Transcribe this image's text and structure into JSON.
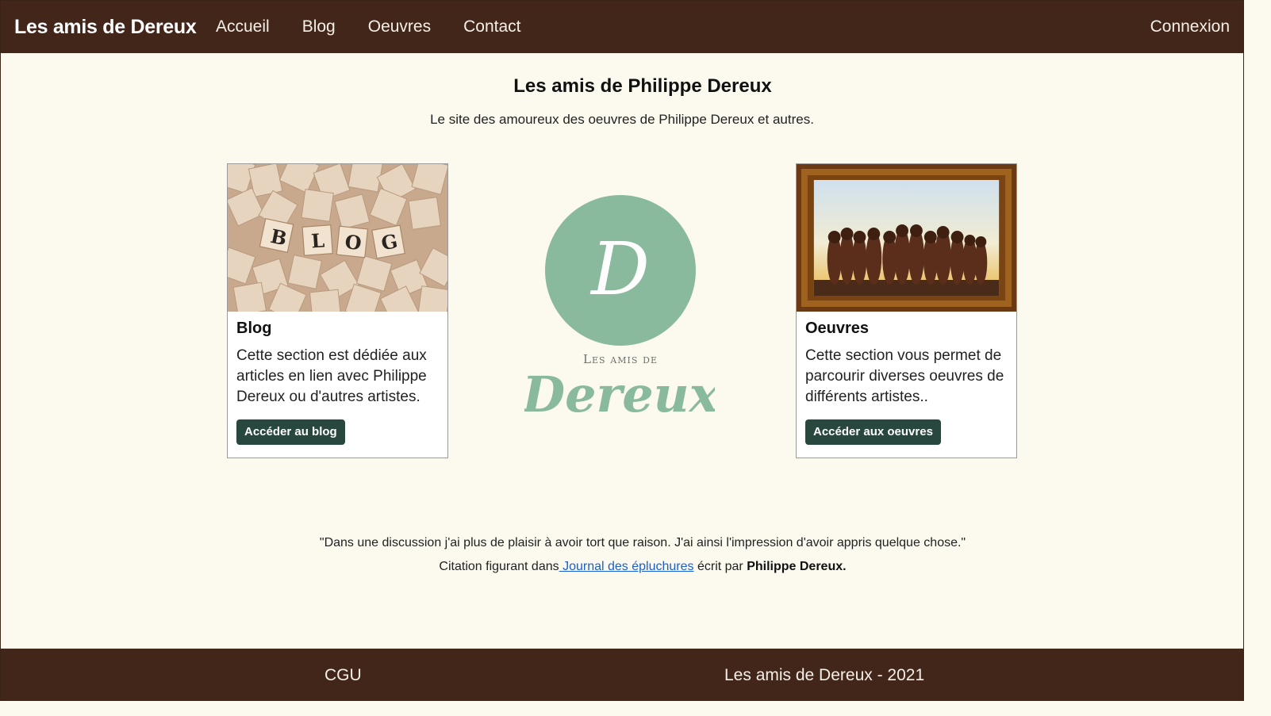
{
  "navbar": {
    "brand": "Les amis de Dereux",
    "links": [
      "Accueil",
      "Blog",
      "Oeuvres",
      "Contact"
    ],
    "login": "Connexion"
  },
  "hero": {
    "title": "Les amis de Philippe Dereux",
    "subtitle": "Le site des amoureux des oeuvres de Philippe Dereux et autres."
  },
  "cards": {
    "blog": {
      "image_alt": "scrabble-tiles-blog",
      "tiles": [
        "B",
        "L",
        "O",
        "G"
      ],
      "title": "Blog",
      "text": "Cette section est dédiée aux articles en lien avec Philippe Dereux ou d'autres artistes.",
      "button": "Accéder au blog"
    },
    "oeuvres": {
      "image_alt": "framed-artwork-figures",
      "title": "Oeuvres",
      "text": "Cette section vous permet de parcourir diverses oeuvres de différents artistes..",
      "button": "Accéder aux oeuvres"
    }
  },
  "logo": {
    "letter": "D",
    "line1": "Les amis de",
    "line2": "Dereux",
    "color": "#8aba9e"
  },
  "quote": {
    "text": "\"Dans une discussion j'ai plus de plaisir à avoir tort que raison. J'ai ainsi l'impression d'avoir appris quelque chose.\"",
    "prefix": "Citation figurant dans",
    "link": " Journal des épluchures",
    "middle": " écrit par ",
    "author": "Philippe Dereux."
  },
  "footer": {
    "cgu": "CGU",
    "copyright": "Les amis de Dereux - 2021"
  },
  "colors": {
    "nav_bg": "#422619",
    "page_bg": "#fcfaee",
    "button_bg": "#28483f",
    "link": "#1a5fd0",
    "logo_green": "#8aba9e"
  }
}
